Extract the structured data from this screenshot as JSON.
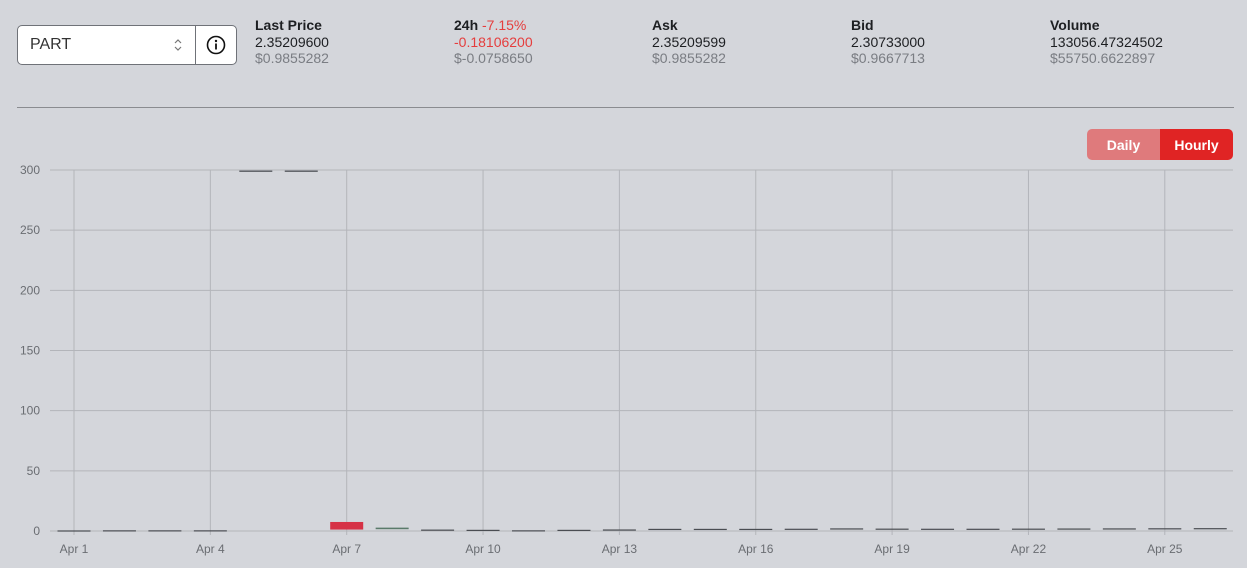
{
  "market": {
    "selected": "PART"
  },
  "stats": {
    "last_price": {
      "label": "Last Price",
      "value": "2.35209600",
      "usd": "$0.9855282"
    },
    "change_24h": {
      "label": "24h",
      "percent": "-7.15%",
      "value": "-0.18106200",
      "usd": "$-0.0758650"
    },
    "ask": {
      "label": "Ask",
      "value": "2.35209599",
      "usd": "$0.9855282"
    },
    "bid": {
      "label": "Bid",
      "value": "2.30733000",
      "usd": "$0.9667713"
    },
    "volume": {
      "label": "Volume",
      "value": "133056.47324502",
      "usd": "$55750.6622897"
    }
  },
  "toggle": {
    "daily": "Daily",
    "hourly": "Hourly",
    "active": "Hourly"
  },
  "colors": {
    "up": "#5a7a6a",
    "down": "#d63246",
    "flat": "#4a4d52",
    "accent": "#e02424"
  },
  "chart_data": {
    "type": "candlestick",
    "ylim": [
      0,
      300
    ],
    "yticks": [
      0,
      50,
      100,
      150,
      200,
      250,
      300
    ],
    "xticks": [
      "Apr 1",
      "Apr 4",
      "Apr 7",
      "Apr 10",
      "Apr 13",
      "Apr 16",
      "Apr 19",
      "Apr 22",
      "Apr 25"
    ],
    "grid": true,
    "candles": [
      {
        "date": "Apr 1",
        "open": 0.5,
        "close": 0.5
      },
      {
        "date": "Apr 2",
        "open": 0.6,
        "close": 0.6
      },
      {
        "date": "Apr 3",
        "open": 0.6,
        "close": 0.6
      },
      {
        "date": "Apr 4",
        "open": 0.6,
        "close": 0.6
      },
      {
        "date": "Apr 5",
        "open": 299.5,
        "close": 299.5
      },
      {
        "date": "Apr 6",
        "open": 299.5,
        "close": 299.5
      },
      {
        "date": "Apr 7",
        "open": 7.5,
        "close": 1.2
      },
      {
        "date": "Apr 8",
        "open": 1.5,
        "close": 2.8
      },
      {
        "date": "Apr 9",
        "open": 1.2,
        "close": 1.2
      },
      {
        "date": "Apr 10",
        "open": 1.0,
        "close": 1.0
      },
      {
        "date": "Apr 11",
        "open": 0.6,
        "close": 0.6
      },
      {
        "date": "Apr 12",
        "open": 1.0,
        "close": 1.0
      },
      {
        "date": "Apr 13",
        "open": 1.3,
        "close": 1.3
      },
      {
        "date": "Apr 14",
        "open": 1.8,
        "close": 1.8
      },
      {
        "date": "Apr 15",
        "open": 1.8,
        "close": 1.8
      },
      {
        "date": "Apr 16",
        "open": 1.8,
        "close": 1.8
      },
      {
        "date": "Apr 17",
        "open": 1.9,
        "close": 1.9
      },
      {
        "date": "Apr 18",
        "open": 2.2,
        "close": 2.2
      },
      {
        "date": "Apr 19",
        "open": 2.0,
        "close": 2.0
      },
      {
        "date": "Apr 20",
        "open": 1.9,
        "close": 1.9
      },
      {
        "date": "Apr 21",
        "open": 1.9,
        "close": 1.9
      },
      {
        "date": "Apr 22",
        "open": 2.0,
        "close": 2.0
      },
      {
        "date": "Apr 23",
        "open": 2.1,
        "close": 2.1
      },
      {
        "date": "Apr 24",
        "open": 2.2,
        "close": 2.2
      },
      {
        "date": "Apr 25",
        "open": 2.3,
        "close": 2.3
      },
      {
        "date": "Apr 26",
        "open": 2.4,
        "close": 2.4
      }
    ]
  }
}
